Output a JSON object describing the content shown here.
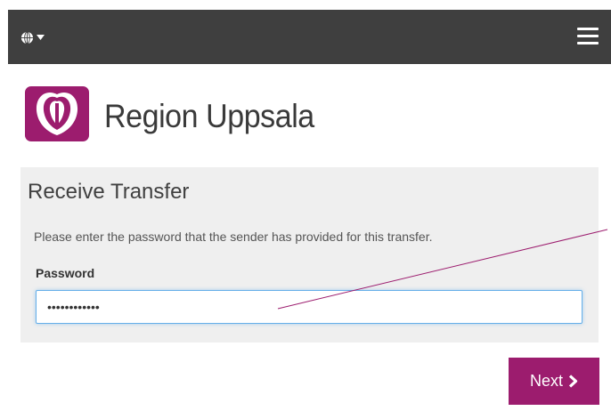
{
  "header": {
    "language_icon": "globe-icon",
    "language_dropdown_icon": "caret-down-icon",
    "menu_icon": "hamburger-menu-icon"
  },
  "brand": {
    "name": "Region Uppsala",
    "logo_icon": "region-uppsala-logo",
    "color": "#9c1c6e"
  },
  "form": {
    "title": "Receive Transfer",
    "instructions": "Please enter the password that the sender has provided for this transfer.",
    "password_label": "Password",
    "password_value": "••••••••••••"
  },
  "actions": {
    "next_label": "Next",
    "next_icon": "chevron-right-icon"
  },
  "colors": {
    "header_bg": "#3f3f3f",
    "panel_bg": "#efefef",
    "accent": "#9c1c6e",
    "input_focus_border": "#66afe9"
  }
}
